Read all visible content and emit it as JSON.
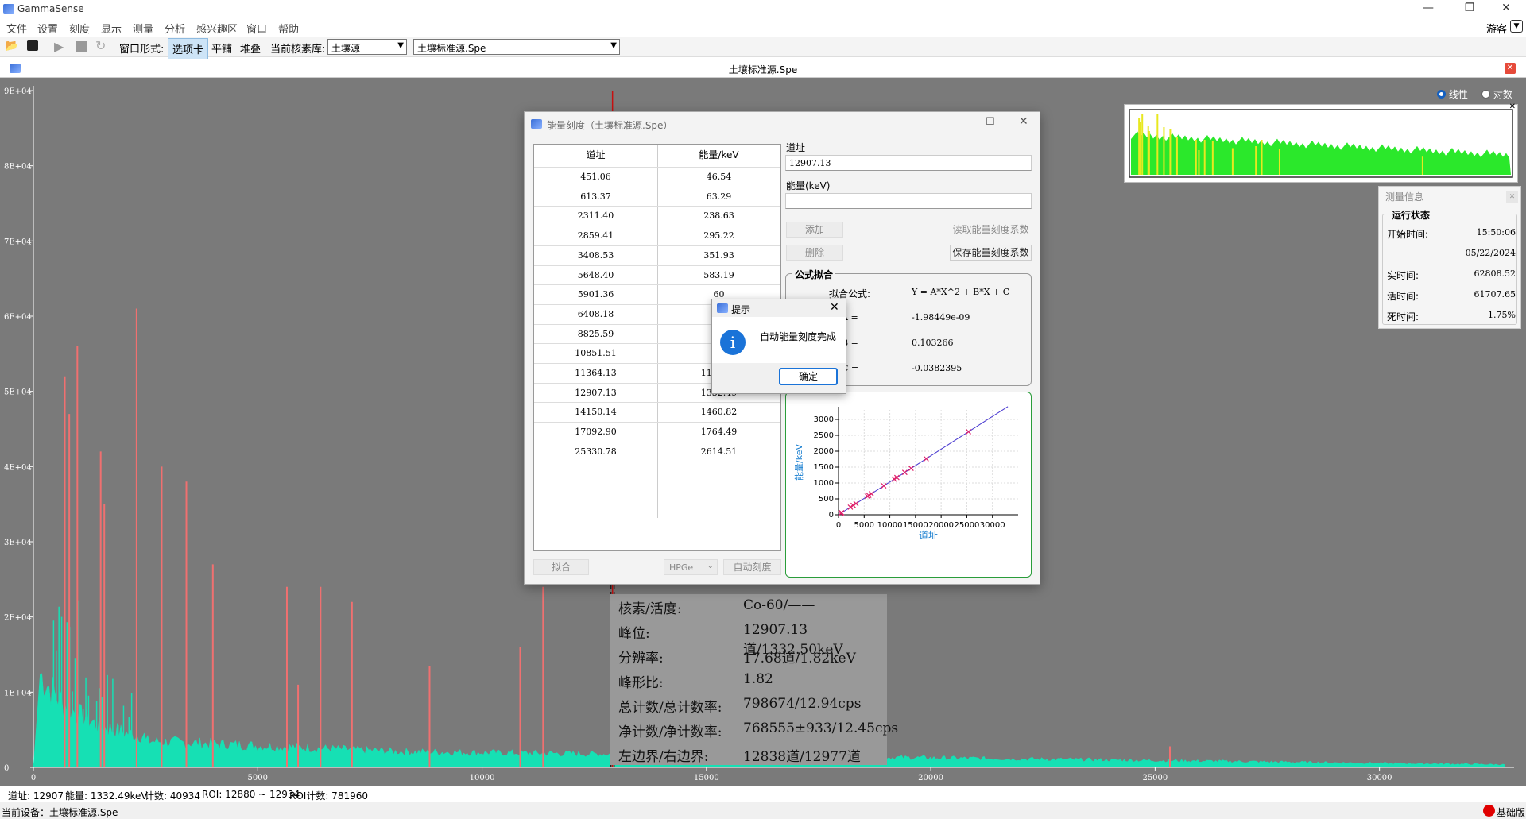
{
  "app": {
    "title": "GammaSense",
    "window_controls": [
      "—",
      "❐",
      "✕"
    ]
  },
  "menu": [
    "文件",
    "设置",
    "刻度",
    "显示",
    "测量",
    "分析",
    "感兴趣区",
    "窗口",
    "帮助"
  ],
  "menu_right": {
    "label": "游客"
  },
  "toolbar": {
    "window_mode_label": "窗口形式:",
    "modes": [
      "选项卡",
      "平铺",
      "堆叠"
    ],
    "nuclide_lib_label": "当前核素库:",
    "nuclide_lib_value": "土壤源",
    "file_value": "土壤标准源.Spe"
  },
  "document": {
    "title": "土壤标准源.Spe"
  },
  "plot": {
    "scale_options": [
      "线性",
      "对数"
    ],
    "scale_selected": "线性",
    "y_ticks": [
      "9E+04",
      "8E+04",
      "7E+04",
      "6E+04",
      "5E+04",
      "4E+04",
      "3E+04",
      "2E+04",
      "1E+04",
      "0"
    ],
    "x_ticks": [
      "0",
      "5000",
      "10000",
      "15000",
      "20000",
      "25000",
      "30000"
    ],
    "xlim": [
      0,
      33000
    ],
    "ylim": [
      0,
      90000
    ],
    "cursor_channel": 12907,
    "peaks": [
      {
        "channel": 700,
        "counts": 52000
      },
      {
        "channel": 800,
        "counts": 47000
      },
      {
        "channel": 980,
        "counts": 56000
      },
      {
        "channel": 1500,
        "counts": 42000
      },
      {
        "channel": 1580,
        "counts": 35000
      },
      {
        "channel": 2300,
        "counts": 61000
      },
      {
        "channel": 2860,
        "counts": 40000
      },
      {
        "channel": 3410,
        "counts": 38000
      },
      {
        "channel": 4000,
        "counts": 27000
      },
      {
        "channel": 5650,
        "counts": 24000
      },
      {
        "channel": 5900,
        "counts": 11000
      },
      {
        "channel": 6400,
        "counts": 24000
      },
      {
        "channel": 7100,
        "counts": 22000
      },
      {
        "channel": 8830,
        "counts": 13500
      },
      {
        "channel": 10850,
        "counts": 16000
      },
      {
        "channel": 11360,
        "counts": 24000
      },
      {
        "channel": 12907,
        "counts": 12000
      },
      {
        "channel": 25330,
        "counts": 2800
      }
    ]
  },
  "status": {
    "channel": "道址: 12907",
    "energy": "能量: 1332.49keV",
    "counts": "计数: 40934",
    "roi": "ROI: 12880 ~ 12934",
    "roi_counts": "ROI计数: 781960",
    "device": "当前设备：土壤标准源.Spe",
    "edition": "基础版"
  },
  "dialog": {
    "title": "能量刻度（土壤标准源.Spe）",
    "table": {
      "headers": [
        "道址",
        "能量/keV"
      ],
      "rows": [
        [
          "451.06",
          "46.54"
        ],
        [
          "613.37",
          "63.29"
        ],
        [
          "2311.40",
          "238.63"
        ],
        [
          "2859.41",
          "295.22"
        ],
        [
          "3408.53",
          "351.93"
        ],
        [
          "5648.40",
          "583.19"
        ],
        [
          "5901.36",
          "60"
        ],
        [
          "6408.18",
          "66"
        ],
        [
          "8825.59",
          "91"
        ],
        [
          "10851.51",
          "11"
        ],
        [
          "11364.13",
          "1173.23"
        ],
        [
          "12907.13",
          "1332.49"
        ],
        [
          "14150.14",
          "1460.82"
        ],
        [
          "17092.90",
          "1764.49"
        ],
        [
          "25330.78",
          "2614.51"
        ]
      ]
    },
    "channel_label": "道址",
    "channel_value": "12907.13",
    "energy_label": "能量(keV)",
    "energy_value": "",
    "add": "添加",
    "delete": "删除",
    "read_coeff": "读取能量刻度系数",
    "save_coeff": "保存能量刻度系数",
    "fit_group": "公式拟合",
    "fit_formula_label": "拟合公式:",
    "fit_formula": "Y = A*X^2 + B*X + C",
    "coef_a_label": "A =",
    "coef_a": "-1.98449e-09",
    "coef_b_label": "B =",
    "coef_b": "0.103266",
    "coef_c_label": "C =",
    "coef_c": "-0.0382395",
    "fit_button": "拟合",
    "detector": "HPGe",
    "auto_calib": "自动刻度"
  },
  "chart_data": {
    "type": "scatter",
    "xlabel": "道址",
    "ylabel": "能量/keV",
    "xlim": [
      0,
      35000
    ],
    "ylim": [
      0,
      3300
    ],
    "x_ticks": [
      "0",
      "5000",
      "10000",
      "15000",
      "20000",
      "25000",
      "30000"
    ],
    "y_ticks": [
      "0",
      "500",
      "1000",
      "1500",
      "2000",
      "2500",
      "3000"
    ],
    "x": [
      451.06,
      613.37,
      2311.4,
      2859.41,
      3408.53,
      5648.4,
      5901.36,
      6408.18,
      8825.59,
      10851.51,
      11364.13,
      12907.13,
      14150.14,
      17092.9,
      25330.78
    ],
    "y": [
      46.54,
      63.29,
      238.63,
      295.22,
      351.93,
      583.19,
      609.3,
      661.66,
      911.2,
      1120.5,
      1173.23,
      1332.49,
      1460.82,
      1764.49,
      2614.51
    ],
    "line": {
      "x": [
        0,
        33000
      ],
      "y": [
        -0.04,
        3405.6
      ]
    }
  },
  "message_box": {
    "title": "提示",
    "text": "自动能量刻度完成",
    "ok": "确定"
  },
  "peak_info": [
    [
      "核素/活度:",
      "Co-60/——"
    ],
    [
      "峰位:",
      "12907.13道/1332.50keV"
    ],
    [
      "分辨率:",
      "17.68道/1.82keV"
    ],
    [
      "峰形比:",
      "1.82"
    ],
    [
      "总计数/总计数率:",
      "798674/12.94cps"
    ],
    [
      "净计数/净计数率:",
      "768555±933/12.45cps"
    ],
    [
      "左边界/右边界:",
      "12838道/12977道"
    ]
  ],
  "measure": {
    "title": "测量信息",
    "group": "运行状态",
    "start_label": "开始时间:",
    "start_time": "15:50:06",
    "start_date": "05/22/2024",
    "real_label": "实时间:",
    "real": "62808.52",
    "live_label": "活时间:",
    "live": "61707.65",
    "dead_label": "死时间:",
    "dead": "1.75%"
  },
  "colors": {
    "spectrum": "#16e0b4",
    "peak": "#f07070",
    "cursor": "#c81010",
    "plot_bg": "#7a7a7a",
    "minimap_fill": "#2be82b",
    "minimap_peak": "#e8e820",
    "fit_line": "#4a3ad0",
    "fit_point": "#e0206a"
  }
}
